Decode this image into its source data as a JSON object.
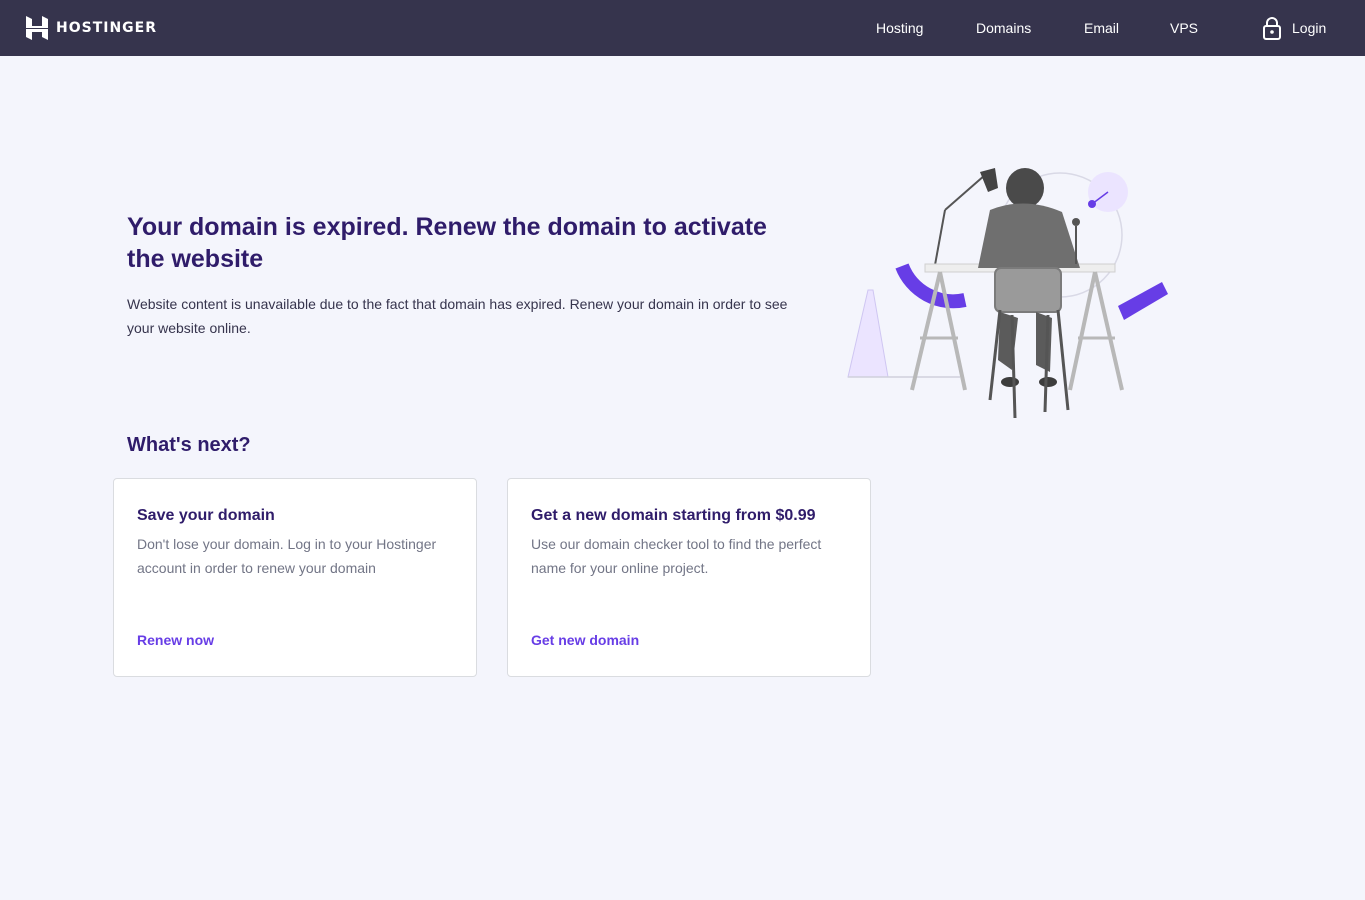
{
  "header": {
    "brand_name": "HOSTINGER",
    "nav": [
      {
        "label": "Hosting"
      },
      {
        "label": "Domains"
      },
      {
        "label": "Email"
      },
      {
        "label": "VPS"
      }
    ],
    "login_label": "Login"
  },
  "main": {
    "headline": "Your domain is expired. Renew the domain to activate the website",
    "lead": "Website content is unavailable due to the fact that domain has expired. Renew your domain in order to see your website online.",
    "whats_next": "What's next?"
  },
  "cards": [
    {
      "title": "Save your domain",
      "text": "Don't lose your domain. Log in to your Hostinger account in order to renew your domain",
      "link": "Renew now"
    },
    {
      "title": "Get a new domain starting from $0.99",
      "text": "Use our domain checker tool to find the perfect name for your online project.",
      "link": "Get new domain"
    }
  ],
  "colors": {
    "header_bg": "#36344d",
    "heading": "#2f1c6a",
    "accent": "#673de6",
    "page_bg": "#f4f5fc"
  },
  "icons": {
    "logo": "hostinger-logo-icon",
    "login": "lock-icon"
  }
}
